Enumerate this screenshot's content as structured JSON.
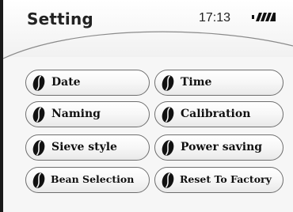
{
  "header": {
    "title": "Setting",
    "time": "17:13",
    "battery_icon": "battery-icon"
  },
  "menu": {
    "icon": "coffee-bean-icon",
    "items": [
      {
        "label": "Date"
      },
      {
        "label": "Time"
      },
      {
        "label": "Naming"
      },
      {
        "label": "Calibration"
      },
      {
        "label": "Sieve style"
      },
      {
        "label": "Power saving"
      },
      {
        "label": "Bean Selection"
      },
      {
        "label": "Reset To Factory"
      }
    ]
  },
  "colors": {
    "background": "#f6f6f6",
    "button_border": "#6e6e6e",
    "text": "#111111"
  }
}
